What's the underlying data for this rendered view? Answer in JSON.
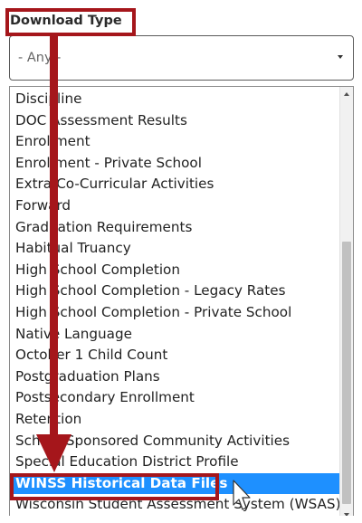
{
  "form": {
    "label": "Download Type",
    "selected_value": "- Any -"
  },
  "dropdown": {
    "options": [
      "Discipline",
      "DOC Assessment Results",
      "Enrollment",
      "Enrollment - Private School",
      "Extra/Co-Curricular Activities",
      "Forward",
      "Graduation Requirements",
      "Habitual Truancy",
      "High School Completion",
      "High School Completion - Legacy Rates",
      "High School Completion - Private School",
      "Native Language",
      "October 1 Child Count",
      "Postgraduation Plans",
      "Postsecondary Enrollment",
      "Retention",
      "School-Sponsored Community Activities",
      "Special Education District Profile",
      "WINSS Historical Data Files",
      "Wisconsin Student Assessment System (WSAS)"
    ],
    "highlighted_option": "WINSS Historical Data Files"
  },
  "colors": {
    "annotation": "#a5161b",
    "highlight": "#1e90ff"
  },
  "icons": {
    "select_caret": "caret-down-icon",
    "scroll_up": "scroll-up-icon",
    "scroll_down": "scroll-down-icon",
    "cursor": "mouse-pointer-icon"
  }
}
